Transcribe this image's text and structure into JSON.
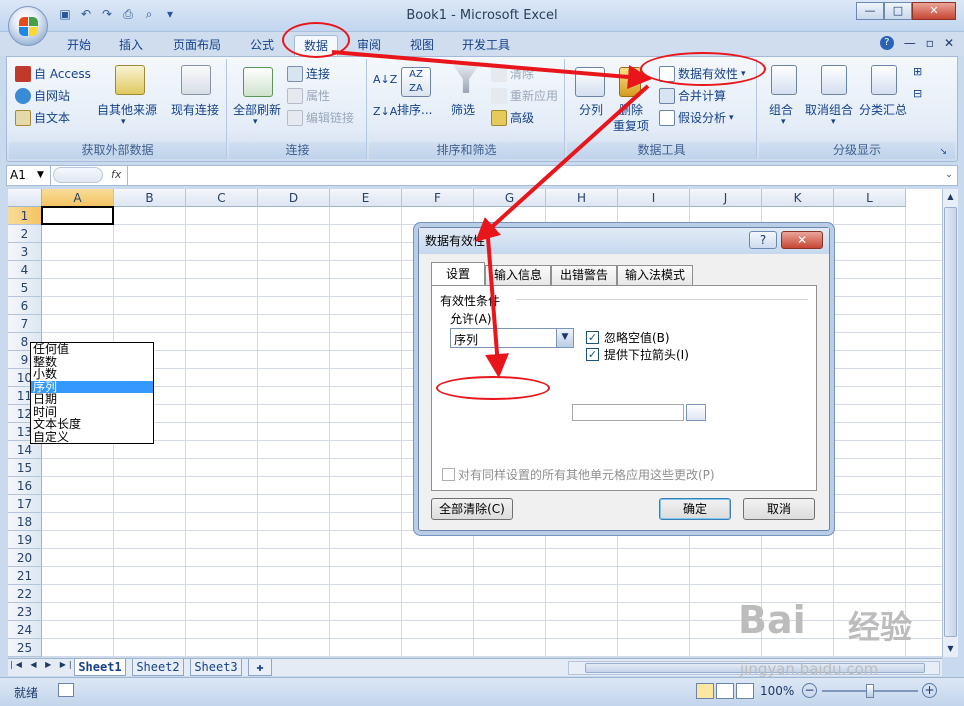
{
  "app": {
    "title": "Book1 - Microsoft Excel"
  },
  "window": {
    "minimize": "—",
    "restore": "□",
    "close": "✕"
  },
  "tabs": [
    {
      "label": "开始"
    },
    {
      "label": "插入"
    },
    {
      "label": "页面布局"
    },
    {
      "label": "公式"
    },
    {
      "label": "数据",
      "active": true
    },
    {
      "label": "审阅"
    },
    {
      "label": "视图"
    },
    {
      "label": "开发工具"
    }
  ],
  "ribbon": {
    "ext": {
      "label": "获取外部数据",
      "access": "自 Access",
      "web": "自网站",
      "text": "自文本",
      "other": "自其他来源",
      "existing": "现有连接"
    },
    "conn": {
      "label": "连接",
      "refresh": "全部刷新",
      "connections": "连接",
      "properties": "属性",
      "edit_links": "编辑链接"
    },
    "sort": {
      "label": "排序和筛选",
      "sort": "排序...",
      "filter": "筛选",
      "clear": "清除",
      "reapply": "重新应用",
      "advanced": "高级"
    },
    "tools": {
      "label": "数据工具",
      "split": "分列",
      "remove": "删除",
      "dup": "重复项",
      "validation": "数据有效性",
      "consolidate": "合并计算",
      "whatif": "假设分析"
    },
    "outline": {
      "label": "分级显示",
      "group": "组合",
      "ungroup": "取消组合",
      "subtotal": "分类汇总"
    }
  },
  "formula": {
    "namebox": "A1",
    "fx": "fx"
  },
  "columns": [
    "A",
    "B",
    "C",
    "D",
    "E",
    "F",
    "G",
    "H",
    "I",
    "J",
    "K",
    "L"
  ],
  "rows": [
    "1",
    "2",
    "3",
    "4",
    "5",
    "6",
    "7",
    "8",
    "9",
    "10",
    "11",
    "12",
    "13",
    "14",
    "15",
    "16",
    "17",
    "18",
    "19",
    "20",
    "21",
    "22",
    "23",
    "24",
    "25"
  ],
  "sheets": [
    "Sheet1",
    "Sheet2",
    "Sheet3"
  ],
  "status": {
    "ready": "就绪",
    "zoom": "100%"
  },
  "dialog": {
    "title": "数据有效性",
    "help": "?",
    "close": "✕",
    "tabs": [
      "设置",
      "输入信息",
      "出错警告",
      "输入法模式"
    ],
    "section": "有效性条件",
    "allow_label": "允许(A):",
    "allow_value": "序列",
    "ignore_blank": "忽略空值(B)",
    "dropdown_arrow": "提供下拉箭头(I)",
    "options": [
      "任何值",
      "整数",
      "小数",
      "序列",
      "日期",
      "时间",
      "文本长度",
      "自定义"
    ],
    "selected_option": "序列",
    "apply_all": "对有同样设置的所有其他单元格应用这些更改(P)",
    "clear_all": "全部清除(C)",
    "ok": "确定",
    "cancel": "取消"
  },
  "watermark": {
    "brand": "Bai",
    "brand2": "经验",
    "url": "jingyan.baidu.com"
  }
}
